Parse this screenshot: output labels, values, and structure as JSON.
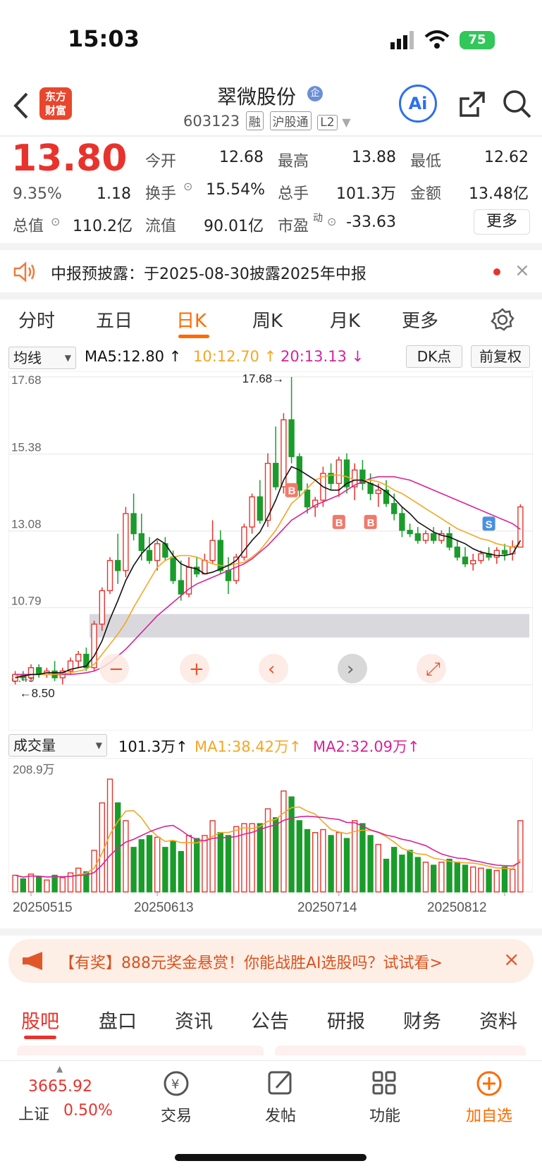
{
  "status": {
    "time": "15:03",
    "battery": "75"
  },
  "header": {
    "logo": "东方\n财富",
    "stock_name": "翠微股份",
    "stock_code": "603123",
    "tags": [
      "融",
      "沪股通",
      "L2"
    ],
    "ai_label": "Ai"
  },
  "quote": {
    "price": "13.80",
    "change_pct": "9.35%",
    "change": "1.18",
    "open_label": "今开",
    "open": "12.68",
    "high_label": "最高",
    "high": "13.88",
    "low_label": "最低",
    "low": "12.62",
    "turnover_label": "换手",
    "turnover": "15.54%",
    "volume_label": "总手",
    "volume": "101.3万",
    "amount_label": "金额",
    "amount": "13.48亿",
    "mcap_label": "总值",
    "mcap": "110.2亿",
    "float_label": "流值",
    "float": "90.01亿",
    "pe_label": "市盈",
    "pe_sup": "动",
    "pe": "-33.63",
    "more": "更多"
  },
  "notice": {
    "text": "中报预披露：于2025-08-30披露2025年中报"
  },
  "tabs": [
    "分时",
    "五日",
    "日K",
    "周K",
    "月K",
    "更多"
  ],
  "chart_controls": {
    "indicator": "均线",
    "ma5": "MA5:12.80",
    "ma10": "10:12.70",
    "ma20": "20:13.13",
    "dk": "DK点",
    "adjust": "前复权",
    "vol_select": "成交量",
    "vol_value": "101.3万",
    "vol_ma1": "MA1:38.42万",
    "vol_ma2": "MA2:32.09万",
    "vol_max": "208.9万",
    "hi_mark": "17.68→",
    "lo_mark": "←8.50",
    "y_labels": [
      "17.68",
      "15.38",
      "13.08",
      "10.79",
      "8.49"
    ],
    "x_labels": [
      "20250515",
      "20250613",
      "20250714",
      "20250812"
    ]
  },
  "banner": {
    "text": "【有奖】888元奖金悬赏！你能战胜AI选股吗？试试看>"
  },
  "bottom_tabs": [
    "股吧",
    "盘口",
    "资讯",
    "公告",
    "研报",
    "财务",
    "资料"
  ],
  "footer": {
    "index_value": "3665.92",
    "index_name": "上证",
    "index_pct": "0.50%",
    "items": [
      "交易",
      "发帖",
      "功能",
      "加自选"
    ]
  },
  "colors": {
    "up": "#e8332d",
    "down": "#1a9c2b",
    "accent": "#ff6a00",
    "ma5": "#111111",
    "ma10": "#f5a623",
    "ma20": "#d6239b"
  },
  "chart_data": {
    "type": "candlestick",
    "ylim": [
      8.49,
      17.68
    ],
    "candles": [
      [
        8.6,
        8.9,
        8.5,
        8.8
      ],
      [
        8.8,
        8.9,
        8.6,
        8.7
      ],
      [
        8.7,
        9.1,
        8.6,
        9.0
      ],
      [
        9.0,
        9.1,
        8.7,
        8.8
      ],
      [
        8.8,
        9.0,
        8.7,
        8.9
      ],
      [
        8.9,
        9.2,
        8.6,
        8.7
      ],
      [
        8.7,
        9.0,
        8.5,
        8.9
      ],
      [
        8.9,
        9.3,
        8.8,
        9.2
      ],
      [
        9.2,
        9.5,
        9.0,
        9.4
      ],
      [
        9.4,
        9.6,
        8.9,
        9.0
      ],
      [
        9.0,
        10.4,
        8.9,
        10.3
      ],
      [
        10.3,
        11.4,
        10.1,
        11.3
      ],
      [
        11.3,
        12.3,
        11.2,
        12.2
      ],
      [
        12.2,
        13.0,
        11.5,
        11.9
      ],
      [
        11.9,
        13.8,
        11.7,
        13.6
      ],
      [
        13.6,
        14.2,
        12.8,
        13.0
      ],
      [
        13.0,
        13.6,
        12.2,
        12.5
      ],
      [
        12.5,
        12.9,
        12.1,
        12.2
      ],
      [
        12.2,
        12.8,
        11.9,
        12.7
      ],
      [
        12.7,
        12.9,
        12.2,
        12.3
      ],
      [
        12.3,
        12.5,
        11.5,
        11.6
      ],
      [
        11.6,
        12.2,
        11.0,
        11.2
      ],
      [
        11.2,
        12.3,
        11.1,
        12.0
      ],
      [
        12.0,
        12.3,
        11.7,
        11.8
      ],
      [
        11.8,
        12.4,
        11.8,
        12.2
      ],
      [
        12.2,
        13.4,
        12.1,
        12.8
      ],
      [
        12.8,
        13.1,
        11.8,
        11.9
      ],
      [
        11.9,
        12.3,
        11.2,
        11.6
      ],
      [
        11.6,
        12.4,
        11.5,
        12.3
      ],
      [
        12.3,
        13.3,
        12.2,
        13.2
      ],
      [
        13.2,
        14.2,
        13.0,
        14.1
      ],
      [
        14.1,
        14.6,
        13.3,
        13.4
      ],
      [
        13.4,
        15.4,
        13.2,
        15.1
      ],
      [
        15.1,
        16.2,
        14.3,
        14.4
      ],
      [
        14.4,
        16.6,
        14.2,
        16.4
      ],
      [
        16.4,
        17.68,
        15.1,
        15.3
      ],
      [
        15.3,
        15.4,
        14.1,
        14.3
      ],
      [
        14.3,
        14.5,
        13.6,
        13.8
      ],
      [
        13.8,
        14.1,
        13.5,
        14.0
      ],
      [
        14.0,
        15.0,
        13.8,
        14.8
      ],
      [
        14.8,
        15.1,
        14.3,
        14.5
      ],
      [
        14.5,
        15.3,
        14.1,
        15.2
      ],
      [
        15.2,
        15.4,
        14.2,
        14.4
      ],
      [
        14.4,
        15.1,
        14.0,
        14.9
      ],
      [
        14.9,
        15.2,
        14.3,
        14.5
      ],
      [
        14.5,
        14.8,
        14.0,
        14.2
      ],
      [
        14.2,
        14.5,
        13.8,
        14.3
      ],
      [
        14.3,
        14.6,
        13.8,
        13.9
      ],
      [
        13.9,
        14.2,
        13.4,
        13.6
      ],
      [
        13.6,
        13.8,
        12.9,
        13.1
      ],
      [
        13.1,
        13.3,
        12.9,
        13.0
      ],
      [
        13.0,
        13.2,
        12.7,
        12.8
      ],
      [
        12.8,
        13.1,
        12.7,
        13.0
      ],
      [
        13.0,
        13.2,
        12.7,
        12.8
      ],
      [
        12.8,
        13.1,
        12.7,
        13.0
      ],
      [
        13.0,
        13.2,
        12.5,
        12.6
      ],
      [
        12.6,
        12.8,
        12.2,
        12.3
      ],
      [
        12.3,
        12.6,
        12.0,
        12.1
      ],
      [
        12.1,
        12.4,
        11.9,
        12.2
      ],
      [
        12.2,
        12.5,
        12.1,
        12.4
      ],
      [
        12.4,
        12.6,
        12.2,
        12.3
      ],
      [
        12.3,
        12.6,
        12.1,
        12.5
      ],
      [
        12.5,
        12.7,
        12.2,
        12.4
      ],
      [
        12.4,
        12.8,
        12.2,
        12.6
      ],
      [
        12.6,
        13.88,
        12.62,
        13.8
      ]
    ],
    "volume": [
      28,
      22,
      30,
      26,
      20,
      28,
      24,
      32,
      40,
      34,
      70,
      150,
      190,
      150,
      120,
      75,
      88,
      95,
      92,
      75,
      85,
      68,
      95,
      90,
      95,
      120,
      100,
      95,
      110,
      115,
      115,
      115,
      140,
      125,
      170,
      160,
      120,
      105,
      100,
      105,
      95,
      100,
      90,
      120,
      115,
      95,
      80,
      55,
      75,
      62,
      70,
      58,
      50,
      45,
      50,
      55,
      50,
      45,
      42,
      40,
      38,
      36,
      42,
      38,
      120
    ],
    "ma5": [
      8.7,
      8.75,
      8.8,
      8.8,
      8.85,
      8.85,
      8.85,
      8.95,
      9.0,
      9.05,
      9.35,
      9.8,
      10.45,
      11.0,
      11.6,
      12.05,
      12.4,
      12.65,
      12.85,
      12.7,
      12.35,
      12.1,
      12.0,
      11.95,
      11.8,
      11.85,
      11.95,
      12.05,
      12.2,
      12.5,
      12.8,
      13.05,
      13.5,
      14.0,
      14.6,
      15.0,
      14.9,
      14.75,
      14.6,
      14.4,
      14.3,
      14.3,
      14.5,
      14.6,
      14.6,
      14.5,
      14.4,
      14.25,
      14.05,
      13.8,
      13.6,
      13.35,
      13.2,
      13.05,
      12.95,
      12.9,
      12.8,
      12.7,
      12.55,
      12.45,
      12.4,
      12.35,
      12.35,
      12.4,
      12.8
    ],
    "ma10": [
      8.75,
      8.75,
      8.78,
      8.8,
      8.8,
      8.8,
      8.82,
      8.85,
      8.9,
      8.95,
      9.1,
      9.4,
      9.7,
      10.0,
      10.35,
      10.8,
      11.2,
      11.6,
      12.0,
      12.2,
      12.3,
      12.35,
      12.35,
      12.3,
      12.2,
      12.1,
      12.05,
      12.05,
      12.1,
      12.15,
      12.3,
      12.5,
      12.8,
      13.1,
      13.5,
      13.9,
      14.1,
      14.35,
      14.6,
      14.7,
      14.75,
      14.75,
      14.7,
      14.6,
      14.6,
      14.6,
      14.55,
      14.45,
      14.3,
      14.2,
      14.05,
      13.9,
      13.75,
      13.6,
      13.45,
      13.3,
      13.15,
      13.05,
      12.95,
      12.85,
      12.8,
      12.7,
      12.65,
      12.6,
      12.7
    ],
    "ma20": [
      8.8,
      8.8,
      8.8,
      8.8,
      8.8,
      8.8,
      8.8,
      8.8,
      8.82,
      8.85,
      8.9,
      9.0,
      9.15,
      9.35,
      9.55,
      9.8,
      10.05,
      10.3,
      10.55,
      10.75,
      10.95,
      11.15,
      11.35,
      11.5,
      11.6,
      11.7,
      11.8,
      11.9,
      12.0,
      12.1,
      12.25,
      12.45,
      12.65,
      12.9,
      13.15,
      13.4,
      13.55,
      13.7,
      13.85,
      13.95,
      14.05,
      14.15,
      14.3,
      14.45,
      14.55,
      14.65,
      14.7,
      14.7,
      14.7,
      14.65,
      14.6,
      14.5,
      14.4,
      14.3,
      14.2,
      14.1,
      14.0,
      13.9,
      13.8,
      13.7,
      13.6,
      13.5,
      13.4,
      13.3,
      13.13
    ]
  }
}
